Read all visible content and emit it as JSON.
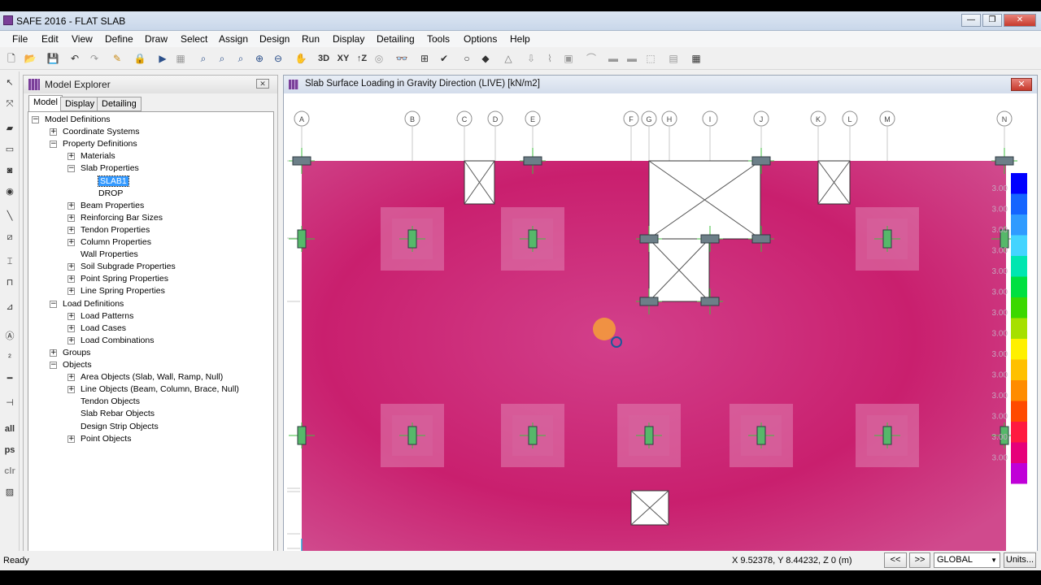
{
  "window": {
    "title": "SAFE 2016 - FLAT SLAB"
  },
  "menu": [
    "File",
    "Edit",
    "View",
    "Define",
    "Draw",
    "Select",
    "Assign",
    "Design",
    "Run",
    "Display",
    "Detailing",
    "Tools",
    "Options",
    "Help"
  ],
  "toolbar_labels": {
    "3d": "3D",
    "xy": "XY",
    "xz": "↑Z"
  },
  "left_tools": {
    "all": "all",
    "ps": "ps",
    "clr": "clr"
  },
  "explorer": {
    "title": "Model Explorer",
    "tabs": [
      "Model",
      "Display",
      "Detailing"
    ],
    "tree": [
      {
        "label": "Model Definitions",
        "level": 0,
        "toggle": "−"
      },
      {
        "label": "Coordinate Systems",
        "level": 1,
        "toggle": "+"
      },
      {
        "label": "Property Definitions",
        "level": 1,
        "toggle": "−"
      },
      {
        "label": "Materials",
        "level": 2,
        "toggle": "+"
      },
      {
        "label": "Slab Properties",
        "level": 2,
        "toggle": "−"
      },
      {
        "label": "SLAB1",
        "level": 3,
        "toggle": "",
        "selected": true
      },
      {
        "label": "DROP",
        "level": 3,
        "toggle": ""
      },
      {
        "label": "Beam Properties",
        "level": 2,
        "toggle": "+"
      },
      {
        "label": "Reinforcing Bar Sizes",
        "level": 2,
        "toggle": "+"
      },
      {
        "label": "Tendon Properties",
        "level": 2,
        "toggle": "+"
      },
      {
        "label": "Column Properties",
        "level": 2,
        "toggle": "+"
      },
      {
        "label": "Wall Properties",
        "level": 2,
        "toggle": ""
      },
      {
        "label": "Soil Subgrade Properties",
        "level": 2,
        "toggle": "+"
      },
      {
        "label": "Point Spring Properties",
        "level": 2,
        "toggle": "+"
      },
      {
        "label": "Line Spring Properties",
        "level": 2,
        "toggle": "+"
      },
      {
        "label": "Load Definitions",
        "level": 1,
        "toggle": "−"
      },
      {
        "label": "Load Patterns",
        "level": 2,
        "toggle": "+"
      },
      {
        "label": "Load Cases",
        "level": 2,
        "toggle": "+"
      },
      {
        "label": "Load Combinations",
        "level": 2,
        "toggle": "+"
      },
      {
        "label": "Groups",
        "level": 1,
        "toggle": "+"
      },
      {
        "label": "Objects",
        "level": 1,
        "toggle": "−"
      },
      {
        "label": "Area Objects (Slab, Wall, Ramp, Null)",
        "level": 2,
        "toggle": "+"
      },
      {
        "label": "Line Objects (Beam, Column, Brace, Null)",
        "level": 2,
        "toggle": "+"
      },
      {
        "label": "Tendon Objects",
        "level": 2,
        "toggle": ""
      },
      {
        "label": "Slab Rebar Objects",
        "level": 2,
        "toggle": ""
      },
      {
        "label": "Design Strip Objects",
        "level": 2,
        "toggle": ""
      },
      {
        "label": "Point Objects",
        "level": 2,
        "toggle": "+"
      }
    ]
  },
  "view": {
    "title": "Slab Surface Loading in Gravity Direction (LIVE)  [kN/m2]",
    "grid_labels": [
      "A",
      "B",
      "C",
      "D",
      "E",
      "F",
      "G",
      "H",
      "I",
      "J",
      "K",
      "L",
      "M",
      "N"
    ],
    "legend_values": [
      "3.00",
      "3.00",
      "3.00",
      "3.00",
      "3.00",
      "3.00",
      "3.00",
      "3.00",
      "3.00",
      "3.00",
      "3.00",
      "3.00",
      "3.00",
      "3.00"
    ],
    "legend_colors": [
      "#0000ff",
      "#1565ff",
      "#2f9bff",
      "#44d4ff",
      "#00e6b0",
      "#00e040",
      "#3cd800",
      "#a6e000",
      "#fff000",
      "#ffc000",
      "#ff8c00",
      "#ff4a00",
      "#ff1a40",
      "#e6007a",
      "#c000d8"
    ],
    "slab_color": "#cc2a78"
  },
  "status": {
    "ready": "Ready",
    "coords": "X 9.52378,  Y 8.44232,  Z 0  (m)",
    "prev": "<<",
    "next": ">>",
    "coord_system": "GLOBAL",
    "units": "Units..."
  }
}
